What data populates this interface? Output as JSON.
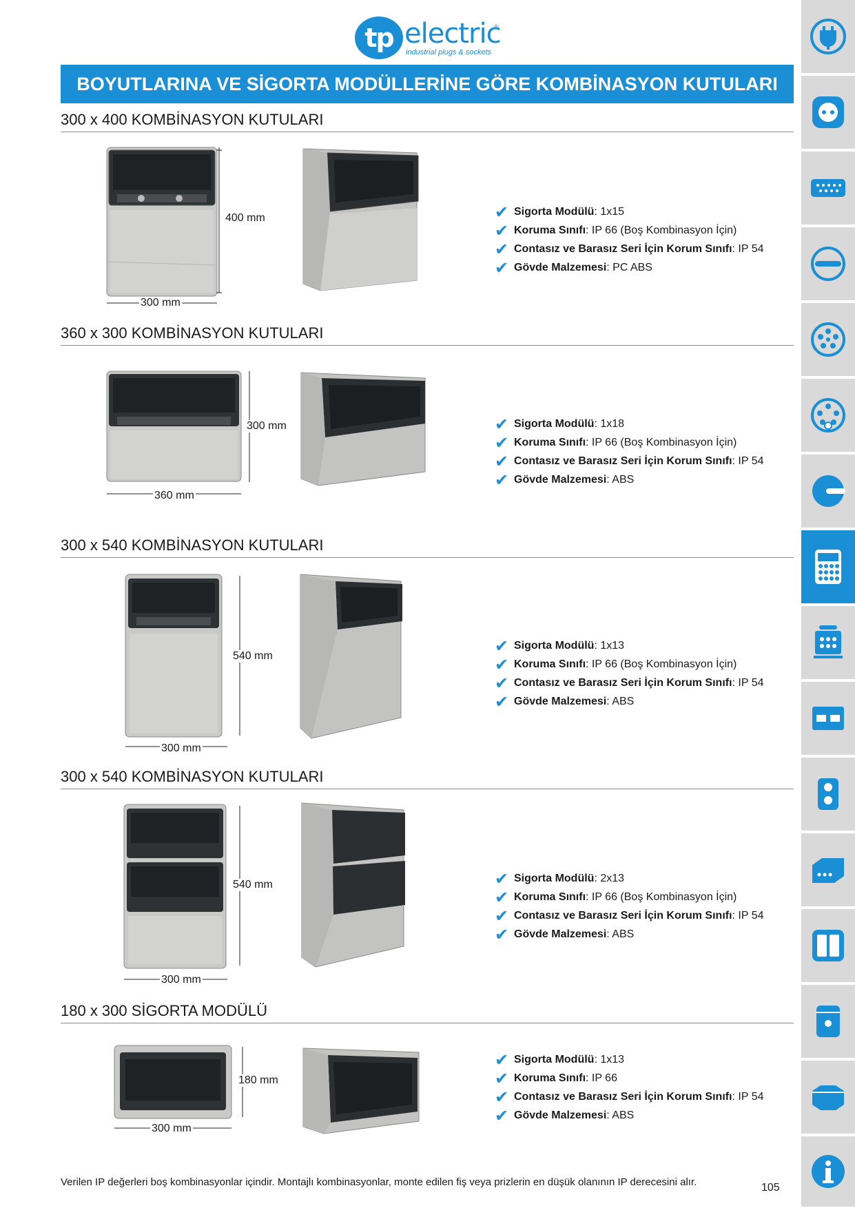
{
  "brand": {
    "mark": "tp",
    "word": "electric",
    "reg": "®",
    "tagline": "industrial plugs & sockets"
  },
  "banner": "BOYUTLARINA VE SİGORTA MODÜLLERİNE GÖRE KOMBİNASYON KUTULARI",
  "sections": [
    {
      "title": "300 x 400 KOMBİNASYON KUTULARI",
      "height_label": "400 mm",
      "width_label": "300 mm",
      "specs": [
        {
          "label": "Sigorta Modülü",
          "value": " : 1x15"
        },
        {
          "label": "Koruma Sınıfı",
          "value": " : IP 66 (Boş Kombinasyon İçin)"
        },
        {
          "label": "Contasız ve Barasız Seri İçin Korum Sınıfı",
          "value": " : IP 54"
        },
        {
          "label": "Gövde Malzemesi",
          "value": " : PC ABS"
        }
      ]
    },
    {
      "title": "360 x 300 KOMBİNASYON KUTULARI",
      "height_label": "300 mm",
      "width_label": "360 mm",
      "specs": [
        {
          "label": "Sigorta Modülü",
          "value": " : 1x18"
        },
        {
          "label": "Koruma Sınıfı",
          "value": " : IP 66 (Boş Kombinasyon İçin)"
        },
        {
          "label": "Contasız ve Barasız Seri İçin Korum Sınıfı",
          "value": " : IP 54"
        },
        {
          "label": "Gövde Malzemesi",
          "value": " : ABS"
        }
      ]
    },
    {
      "title": "300 x 540 KOMBİNASYON KUTULARI",
      "height_label": "540 mm",
      "width_label": "300 mm",
      "specs": [
        {
          "label": "Sigorta Modülü",
          "value": " : 1x13"
        },
        {
          "label": "Koruma Sınıfı",
          "value": " : IP 66 (Boş Kombinasyon İçin)"
        },
        {
          "label": "Contasız ve Barasız Seri İçin Korum Sınıfı",
          "value": " : IP 54"
        },
        {
          "label": "Gövde Malzemesi",
          "value": " : ABS"
        }
      ]
    },
    {
      "title": "300 x 540 KOMBİNASYON KUTULARI",
      "height_label": "540 mm",
      "width_label": "300 mm",
      "specs": [
        {
          "label": "Sigorta Modülü",
          "value": " : 2x13"
        },
        {
          "label": "Koruma Sınıfı",
          "value": " : IP 66 (Boş Kombinasyon İçin)"
        },
        {
          "label": "Contasız ve Barasız Seri İçin Korum Sınıfı",
          "value": " : IP 54"
        },
        {
          "label": "Gövde Malzemesi",
          "value": " : ABS"
        }
      ]
    },
    {
      "title": "180 x 300 SİGORTA MODÜLÜ",
      "height_label": "180 mm",
      "width_label": "300 mm",
      "specs": [
        {
          "label": "Sigorta Modülü",
          "value": " : 1x13"
        },
        {
          "label": "Koruma Sınıfı",
          "value": " : IP 66"
        },
        {
          "label": "Contasız ve Barasız Seri İçin Korum Sınıfı",
          "value": " : IP 54"
        },
        {
          "label": "Gövde Malzemesi",
          "value": " : ABS"
        }
      ]
    }
  ],
  "check_glyph": "✔",
  "footer": "Verilen IP değerleri boş kombinasyonlar içindir. Montajlı kombinasyonlar, monte edilen fiş veya prizlerin en düşük olanının IP derecesini alır.",
  "page_number": "105",
  "sidebar_icons": [
    "plug-icon",
    "socket-icon",
    "multi-pin-connector-icon",
    "industrial-plug-icon",
    "five-pin-socket-icon",
    "five-pin-socket-alt-icon",
    "extension-plug-icon",
    "combination-box-icon",
    "portable-distribution-icon",
    "enclosure-icon",
    "wall-socket-icon",
    "junction-box-icon",
    "double-panel-icon",
    "cylinder-box-icon",
    "hexagon-box-icon",
    "info-icon"
  ],
  "active_sidebar_icon": "combination-box-icon",
  "colors": {
    "accent": "#1a8fd6",
    "tab_bg": "#d9d9d9",
    "rule": "#8a8a8a"
  }
}
